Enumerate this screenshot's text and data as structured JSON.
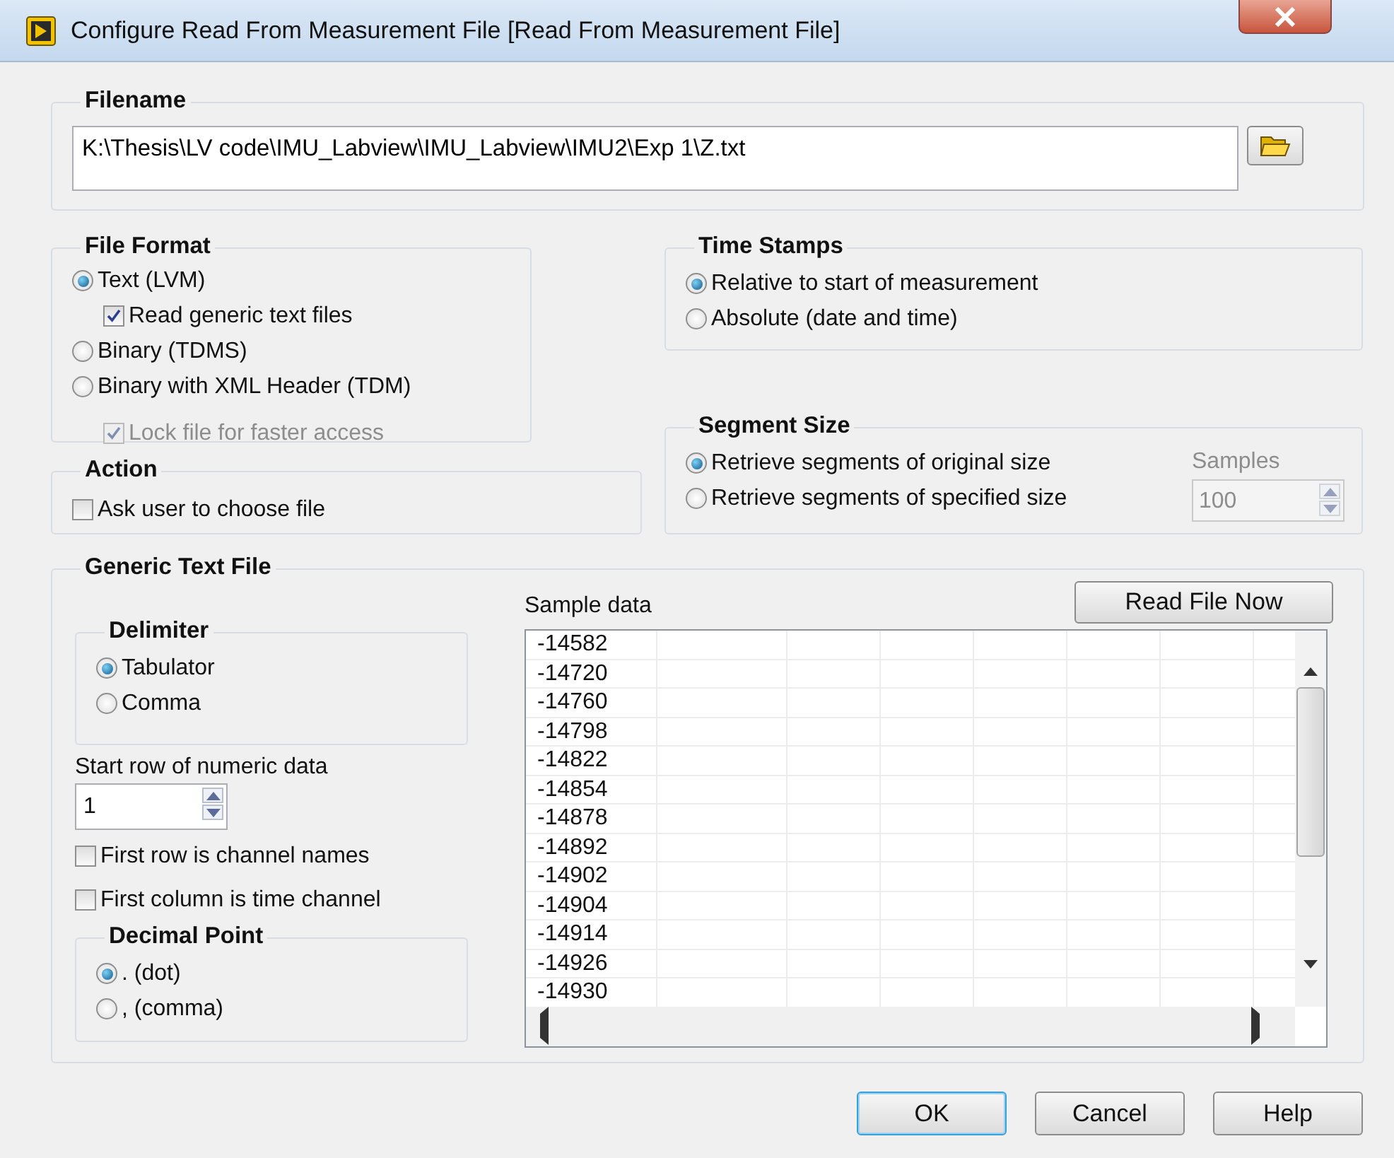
{
  "window": {
    "title": "Configure Read From Measurement File [Read From Measurement File]"
  },
  "filename": {
    "label": "Filename",
    "value": "K:\\Thesis\\LV code\\IMU_Labview\\IMU_Labview\\IMU2\\Exp 1\\Z.txt"
  },
  "file_format": {
    "label": "File Format",
    "items": [
      {
        "kind": "radio",
        "label": "Text (LVM)",
        "selected": true
      },
      {
        "kind": "checkbox",
        "label": "Read generic text files",
        "checked": true,
        "disabled": false
      },
      {
        "kind": "radio",
        "label": "Binary (TDMS)",
        "selected": false
      },
      {
        "kind": "radio",
        "label": "Binary with XML Header (TDM)",
        "selected": false
      },
      {
        "kind": "checkbox",
        "label": "Lock file for faster access",
        "checked": true,
        "disabled": true
      }
    ]
  },
  "action": {
    "label": "Action",
    "items": [
      {
        "label": "Ask user to choose file",
        "checked": false
      }
    ]
  },
  "time_stamps": {
    "label": "Time Stamps",
    "options": [
      {
        "label": "Relative to start of measurement",
        "selected": true
      },
      {
        "label": "Absolute (date and time)",
        "selected": false
      }
    ]
  },
  "segment_size": {
    "label": "Segment Size",
    "options": [
      {
        "label": "Retrieve segments of original size",
        "selected": true
      },
      {
        "label": "Retrieve segments of specified size",
        "selected": false
      }
    ],
    "samples": {
      "label": "Samples",
      "value": "100",
      "disabled": true
    }
  },
  "generic_text_file": {
    "label": "Generic Text File",
    "delimiter": {
      "label": "Delimiter",
      "options": [
        {
          "label": "Tabulator",
          "selected": true
        },
        {
          "label": "Comma",
          "selected": false
        }
      ]
    },
    "start_row": {
      "label": "Start row of numeric data",
      "value": "1"
    },
    "checkboxes": [
      {
        "label": "First row is channel names",
        "checked": false
      },
      {
        "label": "First column is time channel",
        "checked": false
      }
    ],
    "decimal_point": {
      "label": "Decimal Point",
      "options": [
        {
          "label": ". (dot)",
          "selected": true
        },
        {
          "label": ", (comma)",
          "selected": false
        }
      ]
    },
    "sample_data": {
      "label": "Sample data",
      "rows": [
        "-14582",
        "-14720",
        "-14760",
        "-14798",
        "-14822",
        "-14854",
        "-14878",
        "-14892",
        "-14902",
        "-14904",
        "-14914",
        "-14926",
        "-14930"
      ]
    },
    "read_button": "Read File Now"
  },
  "buttons": [
    {
      "label": "OK",
      "default": true
    },
    {
      "label": "Cancel",
      "default": false
    },
    {
      "label": "Help",
      "default": false
    }
  ]
}
